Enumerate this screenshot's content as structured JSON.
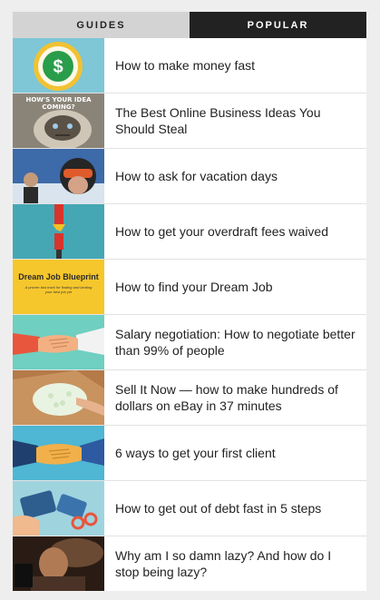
{
  "tabs": {
    "guides": "GUIDES",
    "popular": "POPULAR",
    "active": "popular"
  },
  "articles": [
    {
      "title": "How to make money fast",
      "thumb": "dollar-clock-icon"
    },
    {
      "title": "The Best Online Business Ideas You Should Steal",
      "thumb": "grumpy-cat-meme",
      "thumb_caption": "HOW'S YOUR IDEA COMING?"
    },
    {
      "title": "How to ask for vacation days",
      "thumb": "ski-selfie-photo"
    },
    {
      "title": "How to get your overdraft fees waived",
      "thumb": "torn-card-illustration"
    },
    {
      "title": "How to find your Dream Job",
      "thumb": "dream-job-blueprint-cover",
      "thumb_heading": "Dream Job Blueprint",
      "thumb_subheading": "A proven fast track for finding and landing your best job yet"
    },
    {
      "title": "Salary negotiation: How to negotiate better than 99% of people",
      "thumb": "handshake-illustration"
    },
    {
      "title": "Sell It Now — how to make hundreds of dollars on eBay in 37 minutes",
      "thumb": "shipping-box-photo"
    },
    {
      "title": "6 ways to get your first client",
      "thumb": "handshake-blue-illustration"
    },
    {
      "title": "How to get out of debt fast in 5 steps",
      "thumb": "scissors-credit-card-illustration"
    },
    {
      "title": "Why am I so damn lazy? And how do I stop being lazy?",
      "thumb": "lazy-person-photo"
    }
  ],
  "colors": {
    "tab_active_bg": "#222222",
    "tab_inactive_bg": "#d3d3d3",
    "page_bg": "#eeeeee"
  }
}
